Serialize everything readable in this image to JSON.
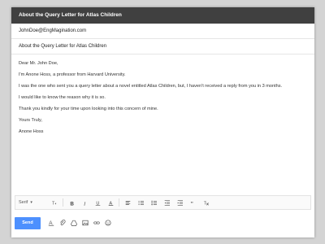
{
  "window": {
    "title": "About the Query Letter for Atlas Children"
  },
  "compose": {
    "to": "JohnDoe@EngMagination.com",
    "subject": "About the Query Letter for Atlas Children",
    "lines": [
      "Dear Mr. John Doe,",
      "I'm Anone Hoss, a professor from Harvard University.",
      "I was the one who sent you a query letter about a novel entitled Atlas Children, but, I haven't received a reply from you in 3 months.",
      "I would like to know the reason why it is so.",
      "Thank you kindly for your time upon looking into this concern of mine.",
      "Yours Truly,",
      "Anone Hoss"
    ]
  },
  "formatting": {
    "font_label": "Serif",
    "icons": [
      "font-size-icon",
      "bold-icon",
      "italic-icon",
      "underline-icon",
      "text-color-icon",
      "align-icon",
      "numbered-list-icon",
      "bulleted-list-icon",
      "indent-less-icon",
      "indent-more-icon",
      "quote-icon",
      "remove-formatting-icon"
    ]
  },
  "bottombar": {
    "send_label": "Send"
  },
  "colors": {
    "titlebar": "#404040",
    "send": "#4d90fe"
  }
}
